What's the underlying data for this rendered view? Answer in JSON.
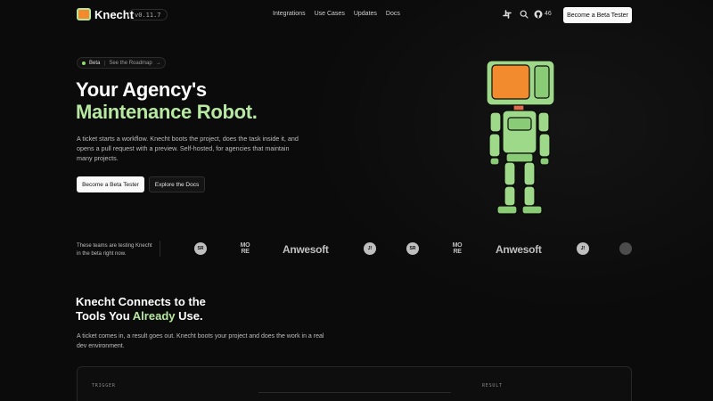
{
  "nav": {
    "brand": "Knecht",
    "version": "v0.11.7",
    "links": [
      "Integrations",
      "Use Cases",
      "Updates",
      "Docs"
    ],
    "stars": "46",
    "cta": "Become a Beta Tester",
    "icons": [
      "slack-icon",
      "search-icon",
      "github-icon"
    ]
  },
  "hero": {
    "pill_badge": "Beta",
    "pill_link": "See the Roadmap",
    "pill_arrow": "→",
    "title_line1": "Your Agency's",
    "title_line2": "Maintenance Robot.",
    "description": "A ticket starts a workflow. Knecht boots the project, does the task inside it, and opens a pull request with a preview. Self-hosted, for agencies that maintain many projects.",
    "primary_button": "Become a Beta Tester",
    "secondary_button": "Explore the Docs"
  },
  "logo_strip": {
    "text": "These teams are testing Knecht in the beta right now.",
    "logos": [
      {
        "type": "circle",
        "text": "SR"
      },
      {
        "type": "more",
        "text": "MO RE"
      },
      {
        "type": "word",
        "text": "Anwesoft"
      },
      {
        "type": "circle",
        "text": "J!"
      },
      {
        "type": "circle",
        "text": "SR"
      },
      {
        "type": "more",
        "text": "MO RE"
      },
      {
        "type": "word",
        "text": "Anwesoft"
      },
      {
        "type": "circle",
        "text": "J!"
      }
    ]
  },
  "section2": {
    "title_line1": "Knecht Connects to the",
    "title_line2_pre": "Tools You ",
    "title_line2_accent": "Already",
    "title_line2_post": " Use.",
    "description": "A ticket comes in, a result goes out. Knecht boots your project and does the work in a real dev environment.",
    "panel_left_label": "TRIGGER",
    "panel_right_label": "RESULT"
  },
  "colors": {
    "accent_green": "#b7e9a0",
    "robot_orange": "#f28a2e",
    "background": "#0b0b0b"
  }
}
